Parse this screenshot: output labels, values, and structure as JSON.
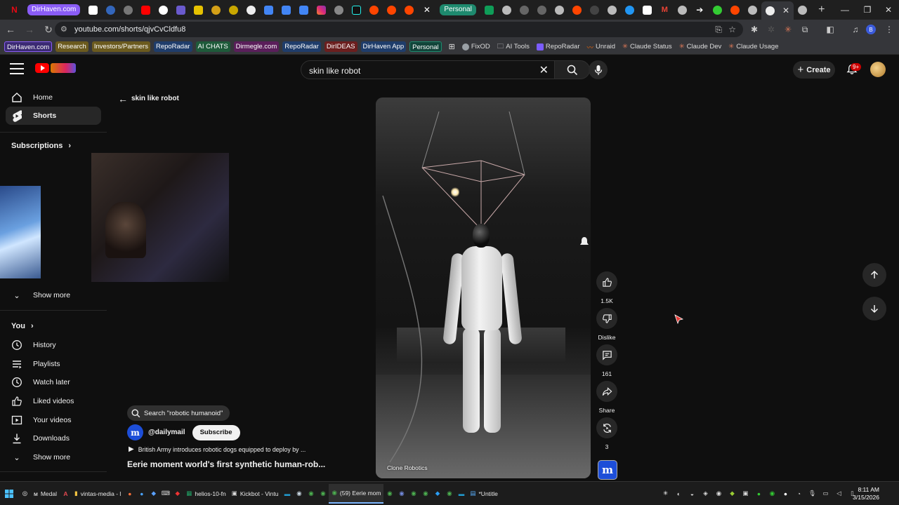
{
  "browser": {
    "tab_groups": [
      "DirHaven.com",
      "Personal"
    ],
    "bookmarks": {
      "chips": [
        {
          "label": "DirHaven.com",
          "color": "#5b3cc4"
        },
        {
          "label": "Research",
          "color": "#6b5a1e"
        },
        {
          "label": "Investors/Partners",
          "color": "#6b5a1e"
        },
        {
          "label": "RepoRadar",
          "color": "#1f3d6b"
        },
        {
          "label": "AI CHATS",
          "color": "#1e5a3a"
        },
        {
          "label": "Dirmegle.com",
          "color": "#5a1e5a"
        },
        {
          "label": "RepoRadar",
          "color": "#1f3d6b"
        },
        {
          "label": "DirIDEAS",
          "color": "#6b1e1e"
        },
        {
          "label": "DirHaven App",
          "color": "#1f3d6b"
        },
        {
          "label": "Personal",
          "color": "#1e6b5a"
        }
      ],
      "items": [
        {
          "label": "FixOD",
          "icon": "globe-icon",
          "color": "#9aa0a6"
        },
        {
          "label": "AI Tools",
          "icon": "folder-icon",
          "color": "#9aa0a6"
        },
        {
          "label": "RepoRadar",
          "icon": "radar-icon",
          "color": "#7b5cff"
        },
        {
          "label": "Unraid",
          "icon": "unraid-icon",
          "color": "#ff6a00"
        },
        {
          "label": "Claude Status",
          "icon": "claude-icon",
          "color": "#d97757"
        },
        {
          "label": "Claude Dev",
          "icon": "claude-icon",
          "color": "#d97757"
        },
        {
          "label": "Claude Usage",
          "icon": "claude-icon",
          "color": "#d97757"
        }
      ]
    },
    "url": "youtube.com/shorts/qjvCvCldfu8"
  },
  "youtube": {
    "search_query": "skin like robot",
    "create_label": "Create",
    "notifications_badge": "9+",
    "sidebar": {
      "home": "Home",
      "shorts": "Shorts",
      "subscriptions": "Subscriptions",
      "show_more_1": "Show more",
      "you": "You",
      "you_items": [
        "History",
        "Playlists",
        "Watch later",
        "Liked videos",
        "Your videos",
        "Downloads"
      ],
      "show_more_2": "Show more"
    },
    "shorts_query": "skin like robot",
    "video": {
      "caption": "Clone Robotics",
      "title": "Eerie moment world's first synthetic human-rob...",
      "channel_handle": "@dailymail",
      "subscribe_label": "Subscribe",
      "search_suggestion": "Search \"robotic humanoid\"",
      "related_video": "British Army introduces robotic dogs equipped to deploy by ..."
    },
    "actions": {
      "likes": "1.5K",
      "dislike": "Dislike",
      "comments": "161",
      "share": "Share",
      "remix": "3"
    }
  },
  "taskbar": {
    "apps": [
      {
        "label": "Medal",
        "active": false
      },
      {
        "label": "vintas-media - l",
        "active": false
      },
      {
        "label": "helios-10-fn",
        "active": false
      },
      {
        "label": "Kickbot - Vintu",
        "active": false
      },
      {
        "label": "(59) Eerie mom",
        "active": true
      },
      {
        "label": "*Untitle",
        "active": false
      }
    ],
    "time": "8:11 AM",
    "date": "3/15/2026"
  }
}
